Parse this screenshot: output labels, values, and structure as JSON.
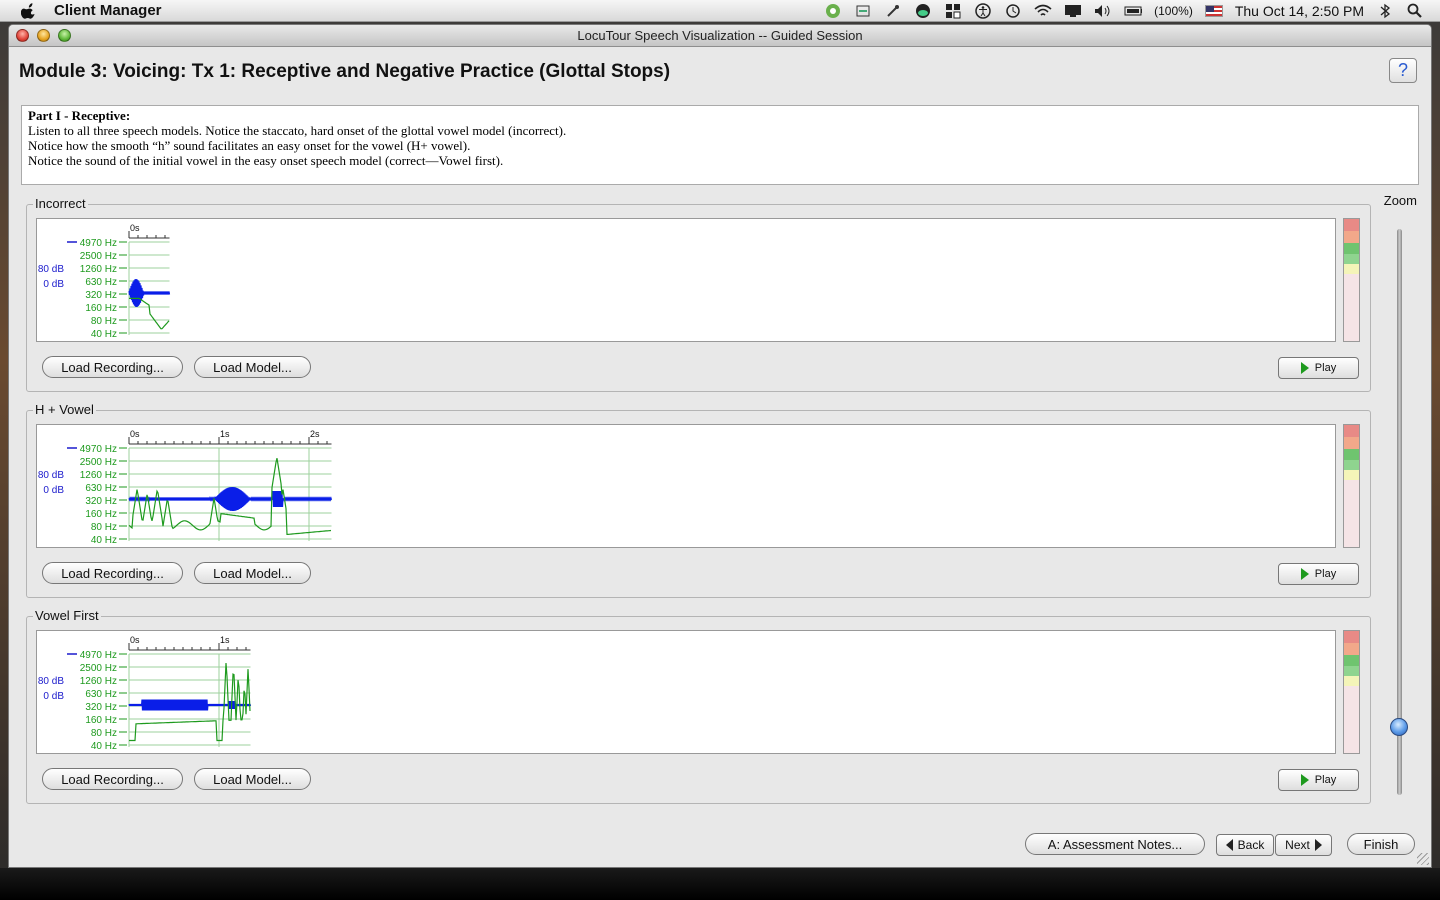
{
  "menubar": {
    "app_name": "Client Manager",
    "battery": "(100%)",
    "datetime": "Thu Oct 14,  2:50 PM"
  },
  "window": {
    "title": "LocuTour Speech Visualization -- Guided Session",
    "module_title": "Module 3: Voicing: Tx 1: Receptive and Negative Practice (Glottal Stops)",
    "help_label": "?"
  },
  "instructions": {
    "heading": "Part I - Receptive:",
    "lines": [
      "Listen to all three speech models. Notice the staccato, hard onset of the glottal vowel model (incorrect).",
      "Notice how the smooth “h” sound facilitates an easy onset for the vowel (H+ vowel).",
      "Notice the sound of the initial vowel in the easy onset speech model (correct—Vowel first)."
    ]
  },
  "zoom": {
    "label": "Zoom",
    "level": 0.12
  },
  "axis": {
    "freq_labels": [
      "4970 Hz",
      "2500 Hz",
      "1260 Hz",
      "630 Hz",
      "320 Hz",
      "160 Hz",
      "80 Hz",
      "40 Hz"
    ],
    "db_labels": [
      "80 dB",
      "0 dB"
    ]
  },
  "panels": [
    {
      "title": "Incorrect",
      "time_labels": [
        "0s"
      ],
      "duration_s": 0.45,
      "load_recording": "Load Recording...",
      "load_model": "Load Model...",
      "play": "Play"
    },
    {
      "title": "H + Vowel",
      "time_labels": [
        "0s",
        "1s",
        "2s"
      ],
      "duration_s": 2.25,
      "load_recording": "Load Recording...",
      "load_model": "Load Model...",
      "play": "Play"
    },
    {
      "title": "Vowel First",
      "time_labels": [
        "0s",
        "1s"
      ],
      "duration_s": 1.35,
      "load_recording": "Load Recording...",
      "load_model": "Load Model...",
      "play": "Play"
    }
  ],
  "footer": {
    "assessment": "A: Assessment Notes...",
    "back": "Back",
    "next": "Next",
    "finish": "Finish"
  },
  "colors": {
    "waveform": "#0a1ee8",
    "pitch": "#1e9a1e",
    "axis_freq": "#1e9a1e",
    "axis_db": "#1a1acc",
    "meter": [
      "#e88a86",
      "#f2a88a",
      "#6fc46f",
      "#8fd48f",
      "#f4f4b8",
      "#f5e4e6"
    ]
  }
}
